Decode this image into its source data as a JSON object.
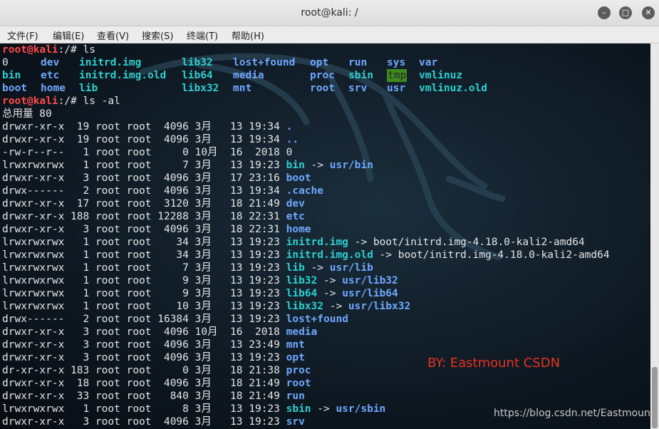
{
  "window": {
    "title": "root@kali: /"
  },
  "menu": [
    "文件(F)",
    "编辑(E)",
    "查看(V)",
    "搜索(S)",
    "终端(T)",
    "帮助(H)"
  ],
  "prompt": {
    "user_host": "root@kali",
    "path": ":/# "
  },
  "commands": {
    "ls": "ls",
    "ls_al": "ls -al"
  },
  "ls_output": [
    [
      "0",
      "dev",
      "initrd.img",
      "lib32",
      "lost+found",
      "opt",
      "run",
      "sys",
      "var"
    ],
    [
      "bin",
      "etc",
      "initrd.img.old",
      "lib64",
      "media",
      "proc",
      "sbin",
      "tmp",
      "vmlinuz"
    ],
    [
      "boot",
      "home",
      "lib",
      "",
      "libx32",
      "mnt",
      "",
      "root",
      "srv",
      "usr",
      "vmlinuz.old"
    ]
  ],
  "total_line": "总用量 80",
  "listing": [
    {
      "meta": "drwxr-xr-x  19 root root  4096 3月   13 19:34 ",
      "name": ".",
      "target": ""
    },
    {
      "meta": "drwxr-xr-x  19 root root  4096 3月   13 19:34 ",
      "name": "..",
      "target": ""
    },
    {
      "meta": "-rw-r--r--   1 root root     0 10月  16  2018 ",
      "name": "0",
      "target": ""
    },
    {
      "meta": "lrwxrwxrwx   1 root root     7 3月   13 19:23 ",
      "name": "bin",
      "target": "usr/bin"
    },
    {
      "meta": "drwxr-xr-x   3 root root  4096 3月   17 23:16 ",
      "name": "boot",
      "target": ""
    },
    {
      "meta": "drwx------   2 root root  4096 3月   13 19:34 ",
      "name": ".cache",
      "target": ""
    },
    {
      "meta": "drwxr-xr-x  17 root root  3120 3月   18 21:49 ",
      "name": "dev",
      "target": ""
    },
    {
      "meta": "drwxr-xr-x 188 root root 12288 3月   18 22:31 ",
      "name": "etc",
      "target": ""
    },
    {
      "meta": "drwxr-xr-x   3 root root  4096 3月   18 22:31 ",
      "name": "home",
      "target": ""
    },
    {
      "meta": "lrwxrwxrwx   1 root root    34 3月   13 19:23 ",
      "name": "initrd.img",
      "target": "boot/initrd.img-4.18.0-kali2-amd64"
    },
    {
      "meta": "lrwxrwxrwx   1 root root    34 3月   13 19:23 ",
      "name": "initrd.img.old",
      "target": "boot/initrd.img-4.18.0-kali2-amd64"
    },
    {
      "meta": "lrwxrwxrwx   1 root root     7 3月   13 19:23 ",
      "name": "lib",
      "target": "usr/lib"
    },
    {
      "meta": "lrwxrwxrwx   1 root root     9 3月   13 19:23 ",
      "name": "lib32",
      "target": "usr/lib32"
    },
    {
      "meta": "lrwxrwxrwx   1 root root     9 3月   13 19:23 ",
      "name": "lib64",
      "target": "usr/lib64"
    },
    {
      "meta": "lrwxrwxrwx   1 root root    10 3月   13 19:23 ",
      "name": "libx32",
      "target": "usr/libx32"
    },
    {
      "meta": "drwx------   2 root root 16384 3月   13 19:23 ",
      "name": "lost+found",
      "target": ""
    },
    {
      "meta": "drwxr-xr-x   3 root root  4096 10月  16  2018 ",
      "name": "media",
      "target": ""
    },
    {
      "meta": "drwxr-xr-x   3 root root  4096 3月   13 23:49 ",
      "name": "mnt",
      "target": ""
    },
    {
      "meta": "drwxr-xr-x   3 root root  4096 3月   13 19:23 ",
      "name": "opt",
      "target": ""
    },
    {
      "meta": "dr-xr-xr-x 183 root root     0 3月   18 21:38 ",
      "name": "proc",
      "target": ""
    },
    {
      "meta": "drwxr-xr-x  18 root root  4096 3月   18 21:49 ",
      "name": "root",
      "target": ""
    },
    {
      "meta": "drwxr-xr-x  33 root root   840 3月   18 21:49 ",
      "name": "run",
      "target": ""
    },
    {
      "meta": "lrwxrwxrwx   1 root root     8 3月   13 19:23 ",
      "name": "sbin",
      "target": "usr/sbin"
    },
    {
      "meta": "drwxr-xr-x   3 root root  4096 3月   13 19:23 ",
      "name": "srv",
      "target": ""
    }
  ],
  "arrow": " -> ",
  "watermark": "BY:  Eastmount CSDN",
  "url_watermark": "https://blog.csdn.net/Eastmount",
  "icons": [
    "minimize-icon",
    "maximize-icon",
    "close-icon"
  ],
  "colors": {
    "dir": "#6fa8ff",
    "link": "#2cd0d0",
    "prompt": "#ff4b4b",
    "tmp_bg": "#3d8a1e"
  }
}
